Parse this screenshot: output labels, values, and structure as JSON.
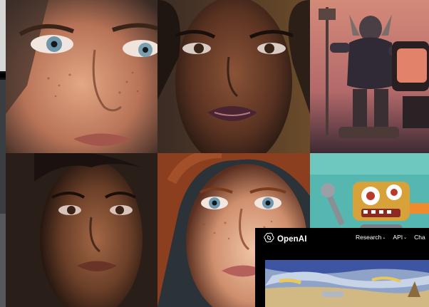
{
  "collage": {
    "tiles": [
      {
        "subject": "portrait-blue-eyes-freckles"
      },
      {
        "subject": "portrait-dark-skin-glossy-lips"
      },
      {
        "subject": "robot-warrior-with-retro-tv"
      },
      {
        "subject": "portrait-dark-skin-soft-light"
      },
      {
        "subject": "portrait-red-hair-freckles"
      },
      {
        "subject": "cartoon-robot-teal-background"
      }
    ]
  },
  "openai_window": {
    "brand": "OpenAI",
    "logo_icon": "openai-logo-icon",
    "nav": [
      {
        "label": "Research",
        "has_dropdown": true
      },
      {
        "label": "API",
        "has_dropdown": true
      },
      {
        "label": "Cha",
        "has_dropdown": false
      }
    ],
    "hero_subject": "impressionist-painting",
    "colors": {
      "background": "#000000",
      "text": "#ffffff"
    }
  }
}
